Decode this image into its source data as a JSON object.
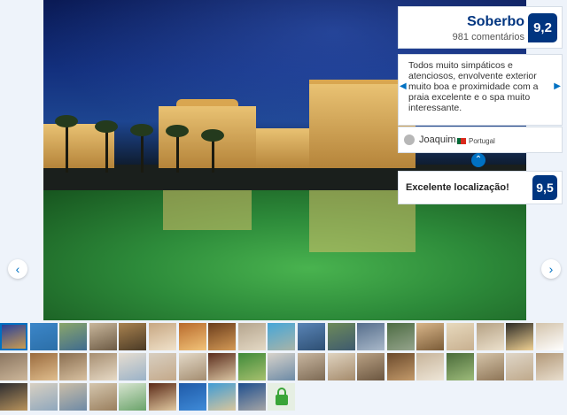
{
  "review": {
    "score_word": "Soberbo",
    "review_count": "981 comentários",
    "score": "9,2",
    "quote": "Todos muito simpáticos e atenciosos, envolvente exterior muito boa e proximidade com a praia excelente e o spa muito interessante.",
    "author_name": "Joaquim,",
    "author_country": "Portugal",
    "prev_quote_icon": "chevron-left-icon",
    "next_quote_icon": "chevron-right-icon",
    "collapse_icon": "chevron-up-icon"
  },
  "feature": {
    "label": "Excelente localização!",
    "score": "9,5"
  },
  "gallery": {
    "prev_icon": "‹",
    "next_icon": "›",
    "thumbnail_rows": [
      {
        "thumbs": [
          {
            "colors": [
              "#1c3aa0",
              "#d6a24a"
            ],
            "selected": true
          },
          {
            "colors": [
              "#3b86c9",
              "#2c6fa8"
            ]
          },
          {
            "colors": [
              "#8aa66b",
              "#3f6b8f"
            ]
          },
          {
            "colors": [
              "#c9b79c",
              "#6c5a44"
            ]
          },
          {
            "colors": [
              "#a9824f",
              "#4a3a26"
            ]
          },
          {
            "colors": [
              "#c7a782",
              "#f0e2cb"
            ]
          },
          {
            "colors": [
              "#b86a2c",
              "#f2c47a"
            ]
          },
          {
            "colors": [
              "#6b3d1c",
              "#d49a56"
            ]
          },
          {
            "colors": [
              "#b5a58e",
              "#e4d9c5"
            ]
          },
          {
            "colors": [
              "#45a6d8",
              "#a9b4a8"
            ]
          },
          {
            "colors": [
              "#5984b6",
              "#2e4f73"
            ]
          },
          {
            "colors": [
              "#6d8a59",
              "#3e5a6f"
            ]
          },
          {
            "colors": [
              "#566e8c",
              "#a9b8c9"
            ]
          },
          {
            "colors": [
              "#4d6c43",
              "#95a48c"
            ]
          },
          {
            "colors": [
              "#d9b68a",
              "#7b5c38"
            ]
          },
          {
            "colors": [
              "#e7d9bd",
              "#c8b090"
            ]
          },
          {
            "colors": [
              "#b5a184",
              "#ece1cd"
            ]
          },
          {
            "colors": [
              "#2c2a26",
              "#f0d193"
            ]
          },
          {
            "colors": [
              "#d3c3ab",
              "#ffffff"
            ]
          }
        ]
      },
      {
        "thumbs": [
          {
            "colors": [
              "#8a7560",
              "#cdb79a"
            ]
          },
          {
            "colors": [
              "#9a6b3e",
              "#e0be8e"
            ]
          },
          {
            "colors": [
              "#8a6e50",
              "#d8c1a1"
            ]
          },
          {
            "colors": [
              "#a78f72",
              "#e7dac6"
            ]
          },
          {
            "colors": [
              "#e6ddd0",
              "#9ab2c8"
            ]
          },
          {
            "colors": [
              "#d8cfc1",
              "#c4a98a"
            ]
          },
          {
            "colors": [
              "#e3d9c8",
              "#a48d70"
            ]
          },
          {
            "colors": [
              "#5b2d1d",
              "#dbc6a3"
            ]
          },
          {
            "colors": [
              "#3f8a3a",
              "#a7c06e"
            ]
          },
          {
            "colors": [
              "#d8d3cb",
              "#6c8aa6"
            ]
          },
          {
            "colors": [
              "#c8b6a0",
              "#7d6a54"
            ]
          },
          {
            "colors": [
              "#dfd3c0",
              "#a58b6c"
            ]
          },
          {
            "colors": [
              "#b9a184",
              "#6b5640"
            ]
          },
          {
            "colors": [
              "#6b4a2c",
              "#c39a6a"
            ]
          },
          {
            "colors": [
              "#c7b49a",
              "#eee6d8"
            ]
          },
          {
            "colors": [
              "#4a6b3a",
              "#9dbb7a"
            ]
          },
          {
            "colors": [
              "#d5c4a9",
              "#8e7557"
            ]
          },
          {
            "colors": [
              "#dfd6c8",
              "#bfa98b"
            ]
          },
          {
            "colors": [
              "#b29878",
              "#e9dfcf"
            ]
          }
        ]
      },
      {
        "thumbs": [
          {
            "colors": [
              "#2c2c30",
              "#b9945c"
            ]
          },
          {
            "colors": [
              "#d8d0c2",
              "#8fa7bd"
            ]
          },
          {
            "colors": [
              "#cbbea8",
              "#6e8aa6"
            ]
          },
          {
            "colors": [
              "#d4c6ae",
              "#9a7f5e"
            ]
          },
          {
            "colors": [
              "#d7e4d0",
              "#6aa36a"
            ]
          },
          {
            "colors": [
              "#5b2a18",
              "#e0c8a0"
            ]
          },
          {
            "colors": [
              "#1f5aa8",
              "#3f8bd8"
            ]
          },
          {
            "colors": [
              "#3f9bd5",
              "#d9c69c"
            ]
          },
          {
            "colors": [
              "#1e4e8e",
              "#a5a5a5"
            ]
          },
          {
            "lock": true
          }
        ]
      }
    ]
  }
}
